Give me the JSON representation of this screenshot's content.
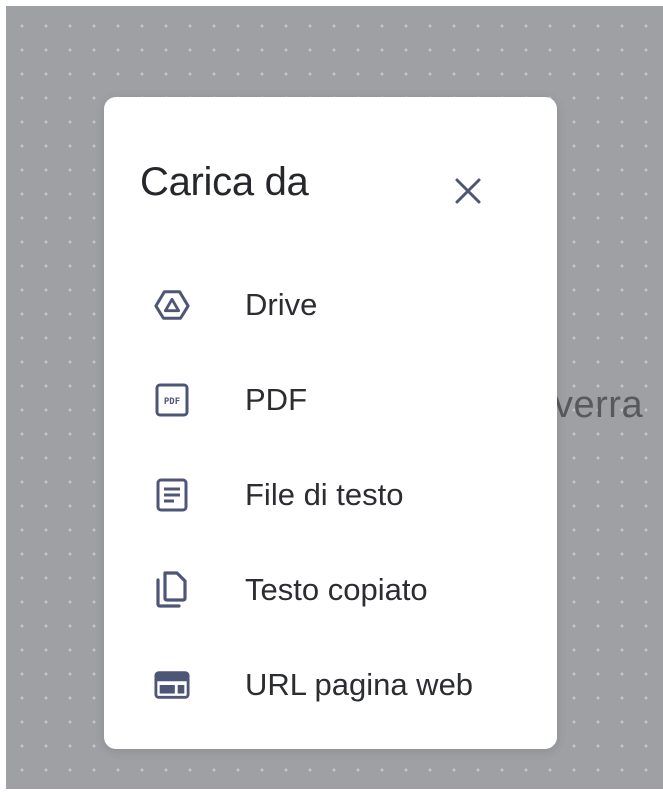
{
  "background": {
    "text_fragment": "verra"
  },
  "dialog": {
    "title": "Carica da",
    "close_icon": "close-icon",
    "items": [
      {
        "icon": "drive-icon",
        "label": "Drive"
      },
      {
        "icon": "pdf-icon",
        "label": "PDF",
        "icon_text": "PDF"
      },
      {
        "icon": "text-file-icon",
        "label": "File di testo"
      },
      {
        "icon": "copied-text-icon",
        "label": "Testo copiato"
      },
      {
        "icon": "web-page-icon",
        "label": "URL pagina web"
      }
    ]
  },
  "colors": {
    "icon": "#4e5678",
    "backdrop": "#9ea0a3",
    "dialog": "#ffffff",
    "text": "#2b2d31"
  }
}
